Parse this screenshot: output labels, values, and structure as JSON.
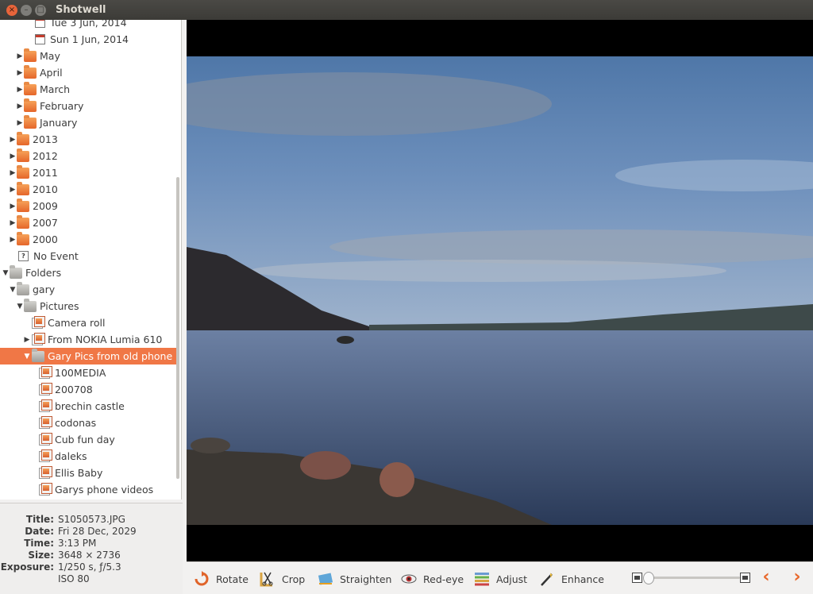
{
  "window": {
    "title": "Shotwell"
  },
  "sidebar": {
    "items": [
      {
        "label": "Tue 3 Jun, 2014",
        "icon": "calendar-icon"
      },
      {
        "label": "Sun 1 Jun, 2014",
        "icon": "calendar-icon"
      },
      {
        "label": "May",
        "icon": "folder-icon"
      },
      {
        "label": "April",
        "icon": "folder-icon"
      },
      {
        "label": "March",
        "icon": "folder-icon"
      },
      {
        "label": "February",
        "icon": "folder-icon"
      },
      {
        "label": "January",
        "icon": "folder-icon"
      },
      {
        "label": "2013",
        "icon": "folder-icon"
      },
      {
        "label": "2012",
        "icon": "folder-icon"
      },
      {
        "label": "2011",
        "icon": "folder-icon"
      },
      {
        "label": "2010",
        "icon": "folder-icon"
      },
      {
        "label": "2009",
        "icon": "folder-icon"
      },
      {
        "label": "2007",
        "icon": "folder-icon"
      },
      {
        "label": "2000",
        "icon": "folder-icon"
      },
      {
        "label": "No Event",
        "icon": "no-event-icon"
      },
      {
        "label": "Folders",
        "icon": "folder-icon"
      },
      {
        "label": "gary",
        "icon": "folder-icon"
      },
      {
        "label": "Pictures",
        "icon": "folder-icon"
      },
      {
        "label": "Camera roll",
        "icon": "photo-folder-icon"
      },
      {
        "label": "From NOKIA Lumia 610",
        "icon": "photo-folder-icon"
      },
      {
        "label": "Gary Pics from old phone",
        "icon": "folder-icon"
      },
      {
        "label": "100MEDIA",
        "icon": "photo-folder-icon"
      },
      {
        "label": "200708",
        "icon": "photo-folder-icon"
      },
      {
        "label": "brechin castle",
        "icon": "photo-folder-icon"
      },
      {
        "label": "codonas",
        "icon": "photo-folder-icon"
      },
      {
        "label": "Cub fun day",
        "icon": "photo-folder-icon"
      },
      {
        "label": "daleks",
        "icon": "photo-folder-icon"
      },
      {
        "label": "Ellis Baby",
        "icon": "photo-folder-icon"
      },
      {
        "label": "Garys phone videos",
        "icon": "photo-folder-icon"
      }
    ],
    "selected": "Gary Pics from old phone"
  },
  "info": {
    "title_label": "Title:",
    "title": "S1050573.JPG",
    "date_label": "Date:",
    "date": "Fri 28 Dec, 2029",
    "time_label": "Time:",
    "time": "3:13 PM",
    "size_label": "Size:",
    "size": "3648 × 2736",
    "exposure_label": "Exposure:",
    "exposure": "1/250 s, ƒ/5.3",
    "iso": "ISO 80"
  },
  "toolbar": {
    "rotate": "Rotate",
    "crop": "Crop",
    "straighten": "Straighten",
    "redeye": "Red-eye",
    "adjust": "Adjust",
    "enhance": "Enhance",
    "prev_icon": "chevron-left-icon",
    "next_icon": "chevron-right-icon",
    "zoom_level": 0.0
  },
  "colors": {
    "accent": "#f07746",
    "titlebar": "#3c3b37",
    "close": "#e8643a"
  }
}
